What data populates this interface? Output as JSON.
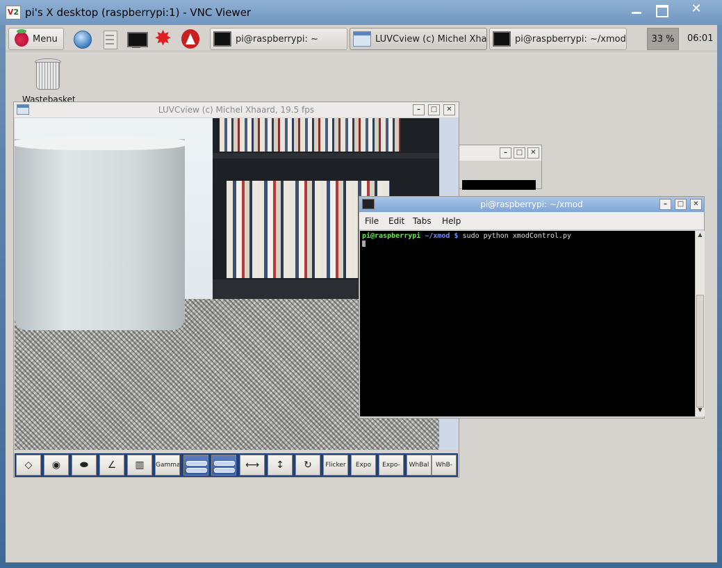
{
  "vnc": {
    "title": "pi's X desktop (raspberrypi:1) - VNC Viewer",
    "logo": "V2"
  },
  "panel": {
    "menu_label": "Menu",
    "tasks": [
      {
        "label": "pi@raspberrypi: ~",
        "icon": "terminal-icon"
      },
      {
        "label": "LUVCview (c) Michel Xhaar...",
        "icon": "window-icon"
      },
      {
        "label": "pi@raspberrypi: ~/xmod",
        "icon": "terminal-icon"
      }
    ],
    "cpu": "33 %",
    "clock": "06:01"
  },
  "desktop": {
    "trash_label": "Wastebasket"
  },
  "luvcview": {
    "title": "LUVCview (c) Michel Xhaard, 19.5 fps",
    "toolbar": [
      "",
      "",
      "",
      "",
      "",
      "Gamma",
      "",
      "",
      "",
      "",
      "",
      "Flicker",
      "Expo",
      "Expo-Auto",
      "WhBal",
      "WhB-Auto"
    ]
  },
  "terminal": {
    "title": "pi@raspberrypi: ~/xmod",
    "menu": [
      "File",
      "Edit",
      "Tabs",
      "Help"
    ],
    "prompt_user": "pi@raspberrypi",
    "prompt_path": "~/xmod $",
    "command": "sudo python xmodControl.py"
  },
  "colors": {
    "title_active": "#7fa5d6",
    "toolbar_bg": "#20427c",
    "prompt_user": "#5cf03c",
    "prompt_path": "#6e8dff"
  }
}
